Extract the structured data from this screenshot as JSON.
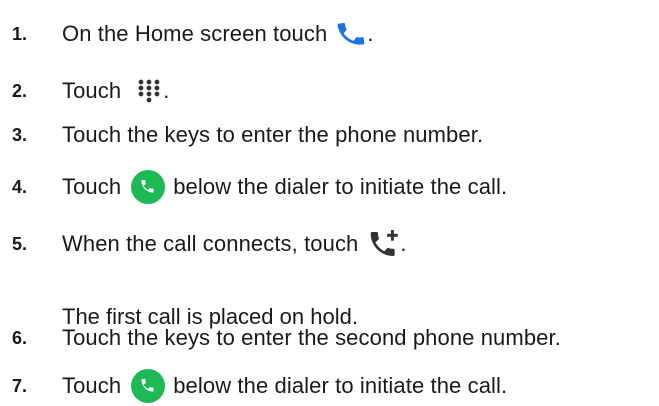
{
  "steps": [
    {
      "number": "1.",
      "before": "On the Home screen touch",
      "icon": "phone-icon",
      "after": "."
    },
    {
      "number": "2.",
      "before": "Touch",
      "icon": "dialpad-icon",
      "after": "."
    },
    {
      "number": "3.",
      "text": "Touch the keys to enter the phone number."
    },
    {
      "number": "4.",
      "before": "Touch",
      "icon": "call-button-icon",
      "after": "below the dialer to initiate the call."
    },
    {
      "number": "5.",
      "before": "When the call connects, touch",
      "icon": "add-call-icon",
      "after": ".",
      "note": "The first call is placed on hold."
    },
    {
      "number": "6.",
      "text": "Touch the keys to enter the second phone number."
    },
    {
      "number": "7.",
      "before": "Touch",
      "icon": "call-button-icon",
      "after": "below the dialer to initiate the call."
    }
  ],
  "colors": {
    "phone_icon": "#1a73e8",
    "call_button": "#1db954",
    "dialpad_icon": "#333333",
    "add_call_icon": "#333333",
    "text": "#1a1a1a"
  }
}
